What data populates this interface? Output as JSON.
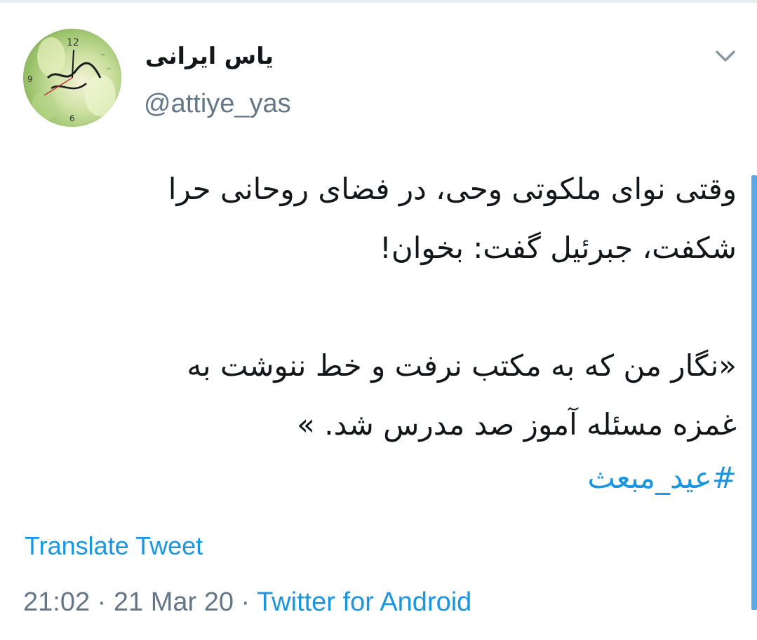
{
  "tweet": {
    "author": {
      "display_name": "یاس ایرانی",
      "handle": "@attiye_yas"
    },
    "body_lines": [
      "وقتی نوای ملکوتی وحی، در فضای روحانی حرا",
      "شکفت، جبرئیل گفت: بخوان!",
      "«نگار من که به مکتب نرفت و خط ننوشت به",
      "غمزه مسئله آموز صد مدرس شد. »"
    ],
    "hashtag": "#عید_مبعث",
    "translate_label": "Translate Tweet",
    "time": "21:02",
    "separator": "·",
    "date": "21 Mar 20",
    "source": "Twitter for Android"
  },
  "icons": {
    "menu": "chevron-down-icon"
  },
  "colors": {
    "link": "#1b95e0",
    "secondary": "#657786",
    "text": "#14171a",
    "scrollbar": "#5aa8e8"
  }
}
